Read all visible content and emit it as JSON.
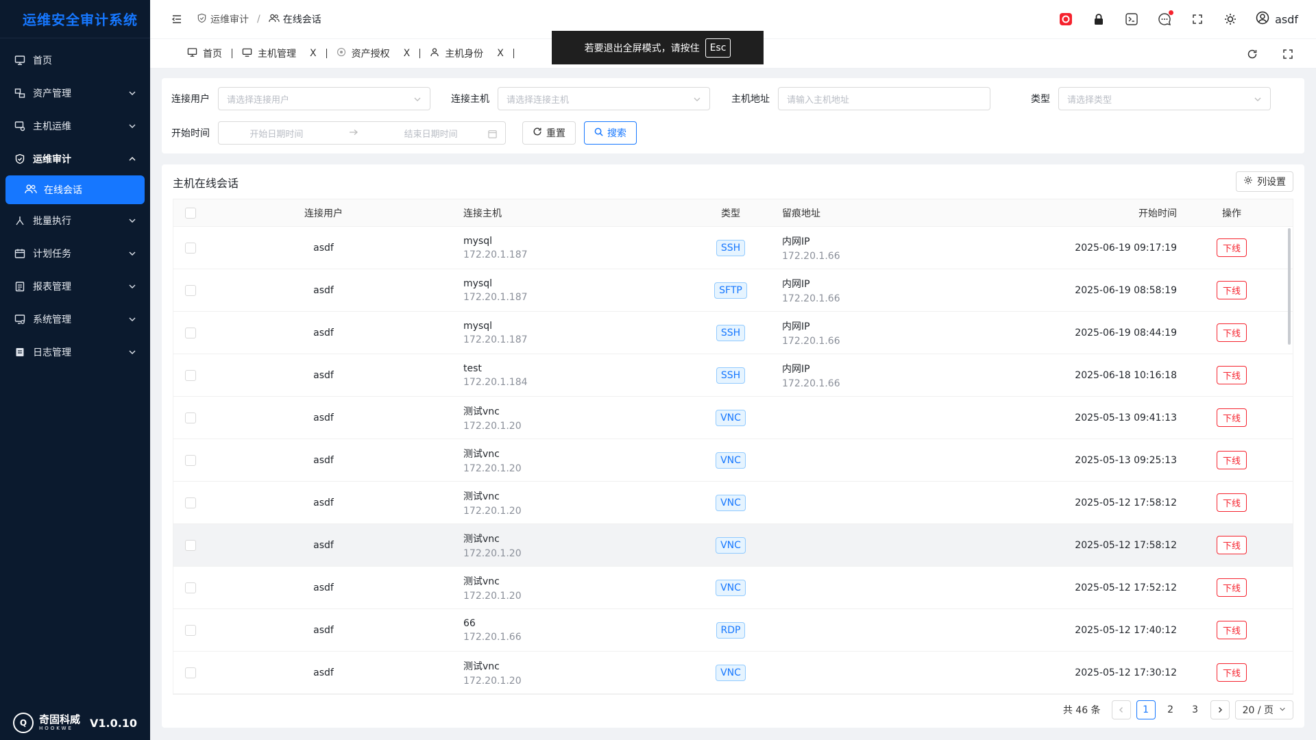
{
  "app": {
    "title": "运维安全审计系统",
    "version": "V1.0.10",
    "brand_cn": "奇固科威",
    "brand_en": "HOOKWE"
  },
  "sidebar": {
    "items": [
      {
        "label": "首页",
        "icon": "monitor-icon"
      },
      {
        "label": "资产管理",
        "icon": "asset-icon"
      },
      {
        "label": "主机运维",
        "icon": "host-ops-icon"
      },
      {
        "label": "运维审计",
        "icon": "shield-check-icon"
      },
      {
        "label": "在线会话",
        "icon": "users-icon"
      },
      {
        "label": "批量执行",
        "icon": "batch-icon"
      },
      {
        "label": "计划任务",
        "icon": "calendar-icon"
      },
      {
        "label": "报表管理",
        "icon": "report-icon"
      },
      {
        "label": "系统管理",
        "icon": "system-icon"
      },
      {
        "label": "日志管理",
        "icon": "log-icon"
      }
    ]
  },
  "header": {
    "breadcrumb": [
      "运维审计",
      "在线会话"
    ],
    "user": "asdf"
  },
  "tabs": [
    {
      "label": "首页"
    },
    {
      "label": "主机管理",
      "close": "X"
    },
    {
      "label": "资产授权",
      "close": "X"
    },
    {
      "label": "主机身份",
      "close": "X"
    }
  ],
  "toast": {
    "text": "若要退出全屏模式，请按住",
    "key": "Esc"
  },
  "filter": {
    "user_label": "连接用户",
    "user_placeholder": "请选择连接用户",
    "host_label": "连接主机",
    "host_placeholder": "请选择连接主机",
    "addr_label": "主机地址",
    "addr_placeholder": "请输入主机地址",
    "type_label": "类型",
    "type_placeholder": "请选择类型",
    "time_label": "开始时间",
    "start_placeholder": "开始日期时间",
    "end_placeholder": "结束日期时间",
    "reset": "重置",
    "search": "搜索"
  },
  "table": {
    "title": "主机在线会话",
    "column_settings": "列设置",
    "headers": [
      "连接用户",
      "连接主机",
      "类型",
      "留痕地址",
      "开始时间",
      "操作"
    ],
    "rows": [
      {
        "user": "asdf",
        "host": "mysql",
        "host_ip": "172.20.1.187",
        "type": "SSH",
        "addr": "内网IP",
        "addr_ip": "172.20.1.66",
        "time": "2025-06-19 09:17:19",
        "action": "下线"
      },
      {
        "user": "asdf",
        "host": "mysql",
        "host_ip": "172.20.1.187",
        "type": "SFTP",
        "addr": "内网IP",
        "addr_ip": "172.20.1.66",
        "time": "2025-06-19 08:58:19",
        "action": "下线"
      },
      {
        "user": "asdf",
        "host": "mysql",
        "host_ip": "172.20.1.187",
        "type": "SSH",
        "addr": "内网IP",
        "addr_ip": "172.20.1.66",
        "time": "2025-06-19 08:44:19",
        "action": "下线"
      },
      {
        "user": "asdf",
        "host": "test",
        "host_ip": "172.20.1.184",
        "type": "SSH",
        "addr": "内网IP",
        "addr_ip": "172.20.1.66",
        "time": "2025-06-18 10:16:18",
        "action": "下线"
      },
      {
        "user": "asdf",
        "host": "测试vnc",
        "host_ip": "172.20.1.20",
        "type": "VNC",
        "addr": "",
        "addr_ip": "",
        "time": "2025-05-13 09:41:13",
        "action": "下线"
      },
      {
        "user": "asdf",
        "host": "测试vnc",
        "host_ip": "172.20.1.20",
        "type": "VNC",
        "addr": "",
        "addr_ip": "",
        "time": "2025-05-13 09:25:13",
        "action": "下线"
      },
      {
        "user": "asdf",
        "host": "测试vnc",
        "host_ip": "172.20.1.20",
        "type": "VNC",
        "addr": "",
        "addr_ip": "",
        "time": "2025-05-12 17:58:12",
        "action": "下线"
      },
      {
        "user": "asdf",
        "host": "测试vnc",
        "host_ip": "172.20.1.20",
        "type": "VNC",
        "addr": "",
        "addr_ip": "",
        "time": "2025-05-12 17:58:12",
        "action": "下线"
      },
      {
        "user": "asdf",
        "host": "测试vnc",
        "host_ip": "172.20.1.20",
        "type": "VNC",
        "addr": "",
        "addr_ip": "",
        "time": "2025-05-12 17:52:12",
        "action": "下线"
      },
      {
        "user": "asdf",
        "host": "66",
        "host_ip": "172.20.1.66",
        "type": "RDP",
        "addr": "",
        "addr_ip": "",
        "time": "2025-05-12 17:40:12",
        "action": "下线"
      },
      {
        "user": "asdf",
        "host": "测试vnc",
        "host_ip": "172.20.1.20",
        "type": "VNC",
        "addr": "",
        "addr_ip": "",
        "time": "2025-05-12 17:30:12",
        "action": "下线"
      }
    ]
  },
  "pagination": {
    "total": "共 46 条",
    "pages": [
      "1",
      "2",
      "3"
    ],
    "current": "1",
    "size": "20 / 页"
  }
}
